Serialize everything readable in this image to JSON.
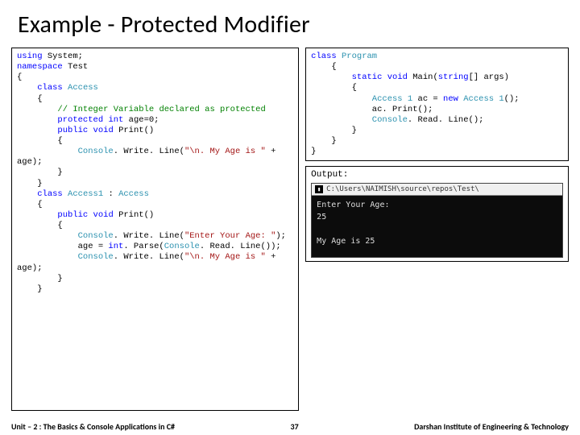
{
  "title": "Example - Protected Modifier",
  "code_left": {
    "t": {
      "using": "using",
      "namespace": "namespace",
      "class": "class",
      "protected": "protected",
      "int": "int",
      "public": "public",
      "void": "void"
    },
    "c": {
      "System": "System",
      "Test": "Test",
      "Access": "Access",
      "Access1": "Access1",
      "Console": "Console"
    },
    "s": {
      "myage": "\"\\n. My Age is \"",
      "enter": "\"Enter Your Age: \"",
      "myage2": "\"\\n. My Age is \""
    },
    "cmt": "// Integer Variable declared as protected",
    "lines": {
      "l1": " System;",
      "l2": " Test",
      "l3": "{",
      "l4a": "    ",
      "l4b": " ",
      "l4c": "Access",
      "l5": "    {",
      "l7a": "        ",
      "l7b": " ",
      "l7c": " age=0;",
      "l8a": "        ",
      "l8b": " ",
      "l8c": " Print()",
      "l9": "        {",
      "l10a": "            ",
      "l10b": ". Write. Line(",
      "l10c": " + ",
      "l11": "age);",
      "l12": "        }",
      "l13": "    }",
      "l14a": "    ",
      "l14b": " ",
      "l14c": " : ",
      "l15": "    {",
      "l16a": "        ",
      "l16b": " ",
      "l16c": " Print()",
      "l17": "        {",
      "l18a": "            ",
      "l18b": ". Write. Line(",
      "l18c": ");",
      "l19a": "            age = ",
      "l19b": ". Parse(",
      "l19c": ". Read. Line());",
      "l20a": "            ",
      "l20b": ". Write. Line(",
      "l20c": " + ",
      "l21": "age);",
      "l22": "        }",
      "l23": "    }"
    }
  },
  "code_right": {
    "t": {
      "class": "class",
      "static": "static",
      "void": "void",
      "string": "string",
      "new": "new"
    },
    "c": {
      "Program": "Program",
      "Access1": "Access 1",
      "Console": "Console"
    },
    "lines": {
      "l1a": "",
      "l1b": " ",
      "l2": "    {",
      "l3a": "        ",
      "l3b": " ",
      "l3c": " Main(",
      "l3d": "[] args)",
      "l4": "        {",
      "l5a": "            ",
      "l5b": " ac = ",
      "l5c": " ",
      "l5d": "();",
      "l6": "            ac. Print();",
      "l7a": "            ",
      "l7b": ". Read. Line();",
      "l8": "        }",
      "l9": "    }",
      "l10": "}"
    }
  },
  "output": {
    "label": "Output:",
    "window_title": "C:\\Users\\NAIMISH\\source\\repos\\Test\\",
    "lines": "Enter Your Age:\n25\n\nMy Age is 25"
  },
  "footer": {
    "unit": "Unit – 2 : The Basics & Console Applications in C#",
    "page": "37",
    "institute": "Darshan Institute of Engineering & Technology"
  }
}
